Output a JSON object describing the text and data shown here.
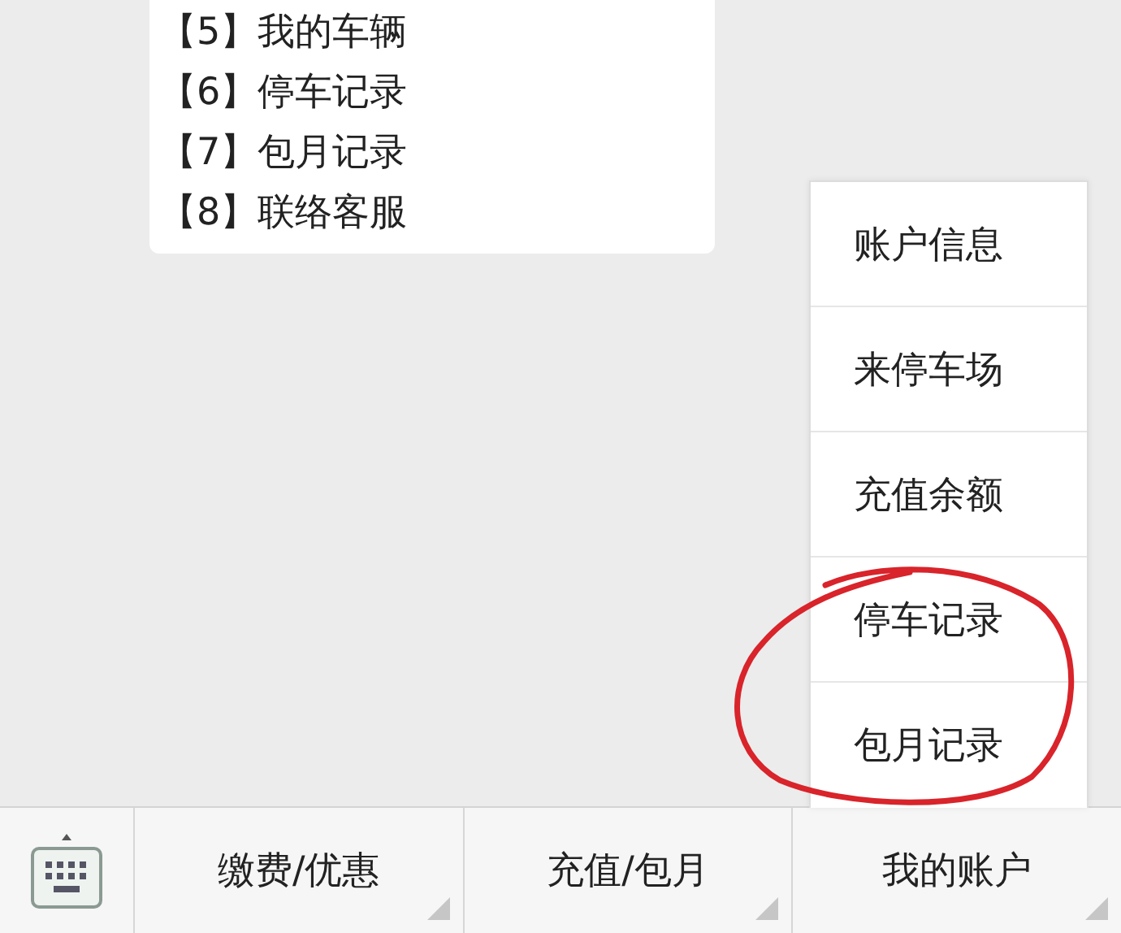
{
  "message": {
    "lines": [
      "【5】我的车辆",
      "【6】停车记录",
      "【7】包月记录",
      "【8】联络客服"
    ]
  },
  "menu_bar": {
    "items": [
      {
        "label": "缴费/优惠"
      },
      {
        "label": "充值/包月"
      },
      {
        "label": "我的账户",
        "submenu": [
          "账户信息",
          "来停车场",
          "充值余额",
          "停车记录",
          "包月记录"
        ]
      }
    ]
  }
}
